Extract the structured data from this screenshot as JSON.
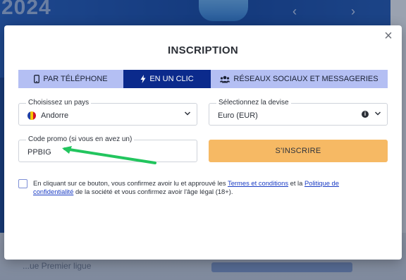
{
  "background": {
    "year_text": "2024",
    "bottom_text": "...ue Premier ligue"
  },
  "modal": {
    "title": "INSCRIPTION",
    "close_symbol": "×",
    "tabs": [
      {
        "label": "PAR TÉLÉPHONE",
        "icon": "phone-icon",
        "active": false
      },
      {
        "label": "EN UN CLIC",
        "icon": "lightning-icon",
        "active": true
      },
      {
        "label": "RÉSEAUX SOCIAUX ET MESSAGERIES",
        "icon": "users-icon",
        "active": false
      }
    ],
    "country": {
      "label": "Choisissez un pays",
      "value": "Andorre",
      "flag_colors": [
        "#1f3fa3",
        "#f6c400",
        "#d2102a"
      ]
    },
    "currency": {
      "label": "Sélectionnez la devise",
      "value": "Euro (EUR)",
      "info_symbol": "i"
    },
    "promo": {
      "label": "Code promo (si vous en avez un)",
      "value": "PPBIG"
    },
    "submit_label": "S'INSCRIRE",
    "terms": {
      "text_1": "En cliquant sur ce bouton, vous confirmez avoir lu et approuvé les ",
      "link_1": "Termes et conditions",
      "text_2": " et la ",
      "link_2": "Politique de confidentialité",
      "text_3": " de la société et vous confirmez avoir l'âge légal (18+)."
    },
    "accent_colors": {
      "active_tab": "#0b2a8c",
      "tab_bar": "#b4bff3",
      "submit": "#f6b964",
      "arrow": "#22c55e"
    }
  }
}
